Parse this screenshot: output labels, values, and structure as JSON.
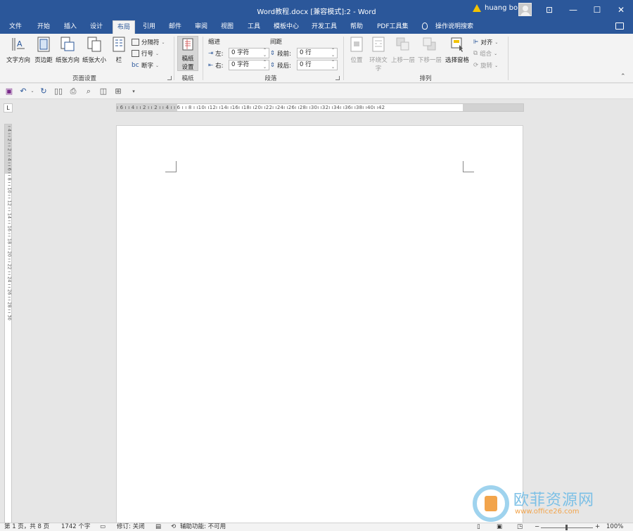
{
  "window": {
    "title": "Word教程.docx [兼容模式]:2  -  Word",
    "user": "huang bo",
    "controls": {
      "ribbon_display": "⊡",
      "minimize": "—",
      "maximize": "☐",
      "close": "✕"
    }
  },
  "tabs": [
    {
      "label": "文件"
    },
    {
      "label": "开始"
    },
    {
      "label": "插入"
    },
    {
      "label": "设计"
    },
    {
      "label": "布局",
      "active": true
    },
    {
      "label": "引用"
    },
    {
      "label": "邮件"
    },
    {
      "label": "审阅"
    },
    {
      "label": "视图"
    },
    {
      "label": "工具"
    },
    {
      "label": "模板中心"
    },
    {
      "label": "开发工具"
    },
    {
      "label": "帮助"
    },
    {
      "label": "PDF工具集"
    },
    {
      "label": "操作说明搜索"
    }
  ],
  "ribbon": {
    "page_setup": {
      "label": "页面设置",
      "text_direction": "文字方向",
      "margins": "页边距",
      "orientation": "纸张方向",
      "size": "纸张大小",
      "columns": "栏",
      "breaks": "分隔符",
      "line_numbers": "行号",
      "hyphenation": "断字"
    },
    "manuscript": {
      "label": "稿纸",
      "button_line1": "稿纸",
      "button_line2": "设置"
    },
    "paragraph": {
      "label": "段落",
      "indent_header": "缩进",
      "spacing_header": "间距",
      "left_label": "左:",
      "left_value": "0 字符",
      "right_label": "右:",
      "right_value": "0 字符",
      "before_label": "段前:",
      "before_value": "0 行",
      "after_label": "段后:",
      "after_value": "0 行"
    },
    "arrange": {
      "label": "排列",
      "position": "位置",
      "wrap_line1": "环绕文",
      "wrap_line2": "字",
      "bring_forward": "上移一层",
      "send_backward": "下移一层",
      "selection_pane": "选择窗格",
      "align": "对齐",
      "group": "组合",
      "rotate": "旋转"
    }
  },
  "ruler": {
    "horizontal_ticks": "ı 6 ı  ı 4 ı  ı 2 ı     ı 2 ı  ı 4 ı  ı 6 ı  ı 8 ı  ı10ı  ı12ı  ı14ı  ı16ı  ı18ı  ı20ı  ı22ı  ı24ı  ı26ı  ı28ı  ı30ı  ı32ı  ı34ı  ı36ı  ı38ı  ı40ı  ı42",
    "vertical_ticks": "ı 4 ı  ı 2 ı           ı 2 ı  ı 4 ı  ı 6 ı  ı 8 ı  ı 10 ı  ı 12 ı  ı 14 ı  ı 16 ı  ı 18 ı  ı 20 ı  ı 22 ı  ı 24 ı  ı 26 ı  ı 28 ı  ı 30",
    "tab_selector": "L"
  },
  "status": {
    "page": "第 1 页，共 8 页",
    "words": "1742 个字",
    "track_changes": "修订: 关闭",
    "accessibility": "辅助功能: 不可用",
    "zoom": "100%",
    "zoom_minus": "−",
    "zoom_plus": "+"
  },
  "watermark": {
    "text": "欧菲资源网",
    "url": "www.office26.com"
  },
  "colors": {
    "accent": "#2b579a",
    "ribbon_bg": "#f3f3f3",
    "workspace_bg": "#e6e6e6"
  }
}
